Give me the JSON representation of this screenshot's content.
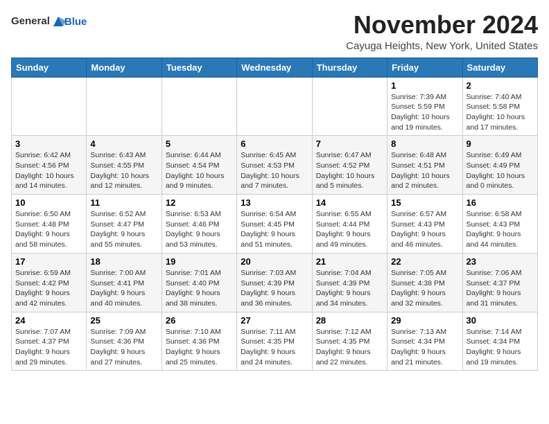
{
  "header": {
    "logo_line1": "General",
    "logo_line2": "Blue",
    "month": "November 2024",
    "location": "Cayuga Heights, New York, United States"
  },
  "weekdays": [
    "Sunday",
    "Monday",
    "Tuesday",
    "Wednesday",
    "Thursday",
    "Friday",
    "Saturday"
  ],
  "weeks": [
    [
      {
        "day": "",
        "info": ""
      },
      {
        "day": "",
        "info": ""
      },
      {
        "day": "",
        "info": ""
      },
      {
        "day": "",
        "info": ""
      },
      {
        "day": "",
        "info": ""
      },
      {
        "day": "1",
        "info": "Sunrise: 7:39 AM\nSunset: 5:59 PM\nDaylight: 10 hours and 19 minutes."
      },
      {
        "day": "2",
        "info": "Sunrise: 7:40 AM\nSunset: 5:58 PM\nDaylight: 10 hours and 17 minutes."
      }
    ],
    [
      {
        "day": "3",
        "info": "Sunrise: 6:42 AM\nSunset: 4:56 PM\nDaylight: 10 hours and 14 minutes."
      },
      {
        "day": "4",
        "info": "Sunrise: 6:43 AM\nSunset: 4:55 PM\nDaylight: 10 hours and 12 minutes."
      },
      {
        "day": "5",
        "info": "Sunrise: 6:44 AM\nSunset: 4:54 PM\nDaylight: 10 hours and 9 minutes."
      },
      {
        "day": "6",
        "info": "Sunrise: 6:45 AM\nSunset: 4:53 PM\nDaylight: 10 hours and 7 minutes."
      },
      {
        "day": "7",
        "info": "Sunrise: 6:47 AM\nSunset: 4:52 PM\nDaylight: 10 hours and 5 minutes."
      },
      {
        "day": "8",
        "info": "Sunrise: 6:48 AM\nSunset: 4:51 PM\nDaylight: 10 hours and 2 minutes."
      },
      {
        "day": "9",
        "info": "Sunrise: 6:49 AM\nSunset: 4:49 PM\nDaylight: 10 hours and 0 minutes."
      }
    ],
    [
      {
        "day": "10",
        "info": "Sunrise: 6:50 AM\nSunset: 4:48 PM\nDaylight: 9 hours and 58 minutes."
      },
      {
        "day": "11",
        "info": "Sunrise: 6:52 AM\nSunset: 4:47 PM\nDaylight: 9 hours and 55 minutes."
      },
      {
        "day": "12",
        "info": "Sunrise: 6:53 AM\nSunset: 4:46 PM\nDaylight: 9 hours and 53 minutes."
      },
      {
        "day": "13",
        "info": "Sunrise: 6:54 AM\nSunset: 4:45 PM\nDaylight: 9 hours and 51 minutes."
      },
      {
        "day": "14",
        "info": "Sunrise: 6:55 AM\nSunset: 4:44 PM\nDaylight: 9 hours and 49 minutes."
      },
      {
        "day": "15",
        "info": "Sunrise: 6:57 AM\nSunset: 4:43 PM\nDaylight: 9 hours and 46 minutes."
      },
      {
        "day": "16",
        "info": "Sunrise: 6:58 AM\nSunset: 4:43 PM\nDaylight: 9 hours and 44 minutes."
      }
    ],
    [
      {
        "day": "17",
        "info": "Sunrise: 6:59 AM\nSunset: 4:42 PM\nDaylight: 9 hours and 42 minutes."
      },
      {
        "day": "18",
        "info": "Sunrise: 7:00 AM\nSunset: 4:41 PM\nDaylight: 9 hours and 40 minutes."
      },
      {
        "day": "19",
        "info": "Sunrise: 7:01 AM\nSunset: 4:40 PM\nDaylight: 9 hours and 38 minutes."
      },
      {
        "day": "20",
        "info": "Sunrise: 7:03 AM\nSunset: 4:39 PM\nDaylight: 9 hours and 36 minutes."
      },
      {
        "day": "21",
        "info": "Sunrise: 7:04 AM\nSunset: 4:39 PM\nDaylight: 9 hours and 34 minutes."
      },
      {
        "day": "22",
        "info": "Sunrise: 7:05 AM\nSunset: 4:38 PM\nDaylight: 9 hours and 32 minutes."
      },
      {
        "day": "23",
        "info": "Sunrise: 7:06 AM\nSunset: 4:37 PM\nDaylight: 9 hours and 31 minutes."
      }
    ],
    [
      {
        "day": "24",
        "info": "Sunrise: 7:07 AM\nSunset: 4:37 PM\nDaylight: 9 hours and 29 minutes."
      },
      {
        "day": "25",
        "info": "Sunrise: 7:09 AM\nSunset: 4:36 PM\nDaylight: 9 hours and 27 minutes."
      },
      {
        "day": "26",
        "info": "Sunrise: 7:10 AM\nSunset: 4:36 PM\nDaylight: 9 hours and 25 minutes."
      },
      {
        "day": "27",
        "info": "Sunrise: 7:11 AM\nSunset: 4:35 PM\nDaylight: 9 hours and 24 minutes."
      },
      {
        "day": "28",
        "info": "Sunrise: 7:12 AM\nSunset: 4:35 PM\nDaylight: 9 hours and 22 minutes."
      },
      {
        "day": "29",
        "info": "Sunrise: 7:13 AM\nSunset: 4:34 PM\nDaylight: 9 hours and 21 minutes."
      },
      {
        "day": "30",
        "info": "Sunrise: 7:14 AM\nSunset: 4:34 PM\nDaylight: 9 hours and 19 minutes."
      }
    ]
  ]
}
